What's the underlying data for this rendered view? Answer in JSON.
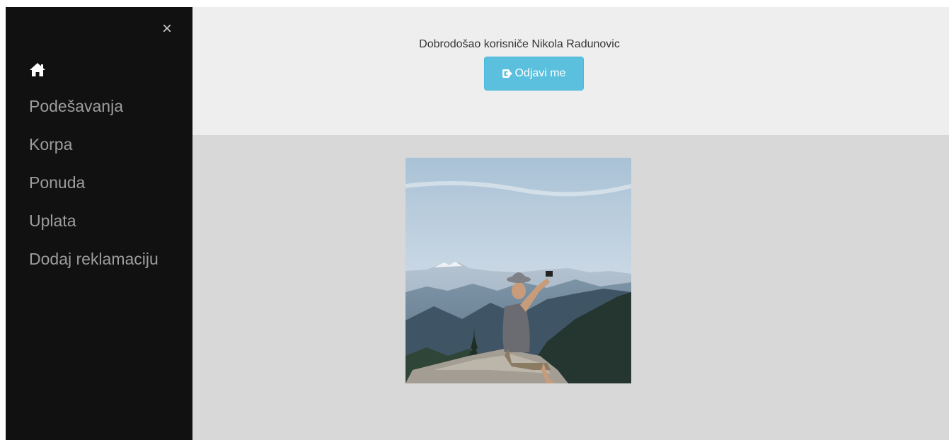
{
  "sidebar": {
    "close_symbol": "×",
    "home_icon": "home-icon",
    "items": [
      {
        "label": "Podešavanja"
      },
      {
        "label": "Korpa"
      },
      {
        "label": "Ponuda"
      },
      {
        "label": "Uplata"
      },
      {
        "label": "Dodaj reklamaciju"
      }
    ]
  },
  "header": {
    "welcome_text": "Dobrodošao korisniče Nikola Radunovic",
    "logout_label": "Odjavi me",
    "logout_icon": "log-out-icon"
  },
  "colors": {
    "sidebar_bg": "#111111",
    "header_bg": "#eeeeee",
    "content_bg": "#d8d8d8",
    "button_info": "#5bc0de"
  }
}
